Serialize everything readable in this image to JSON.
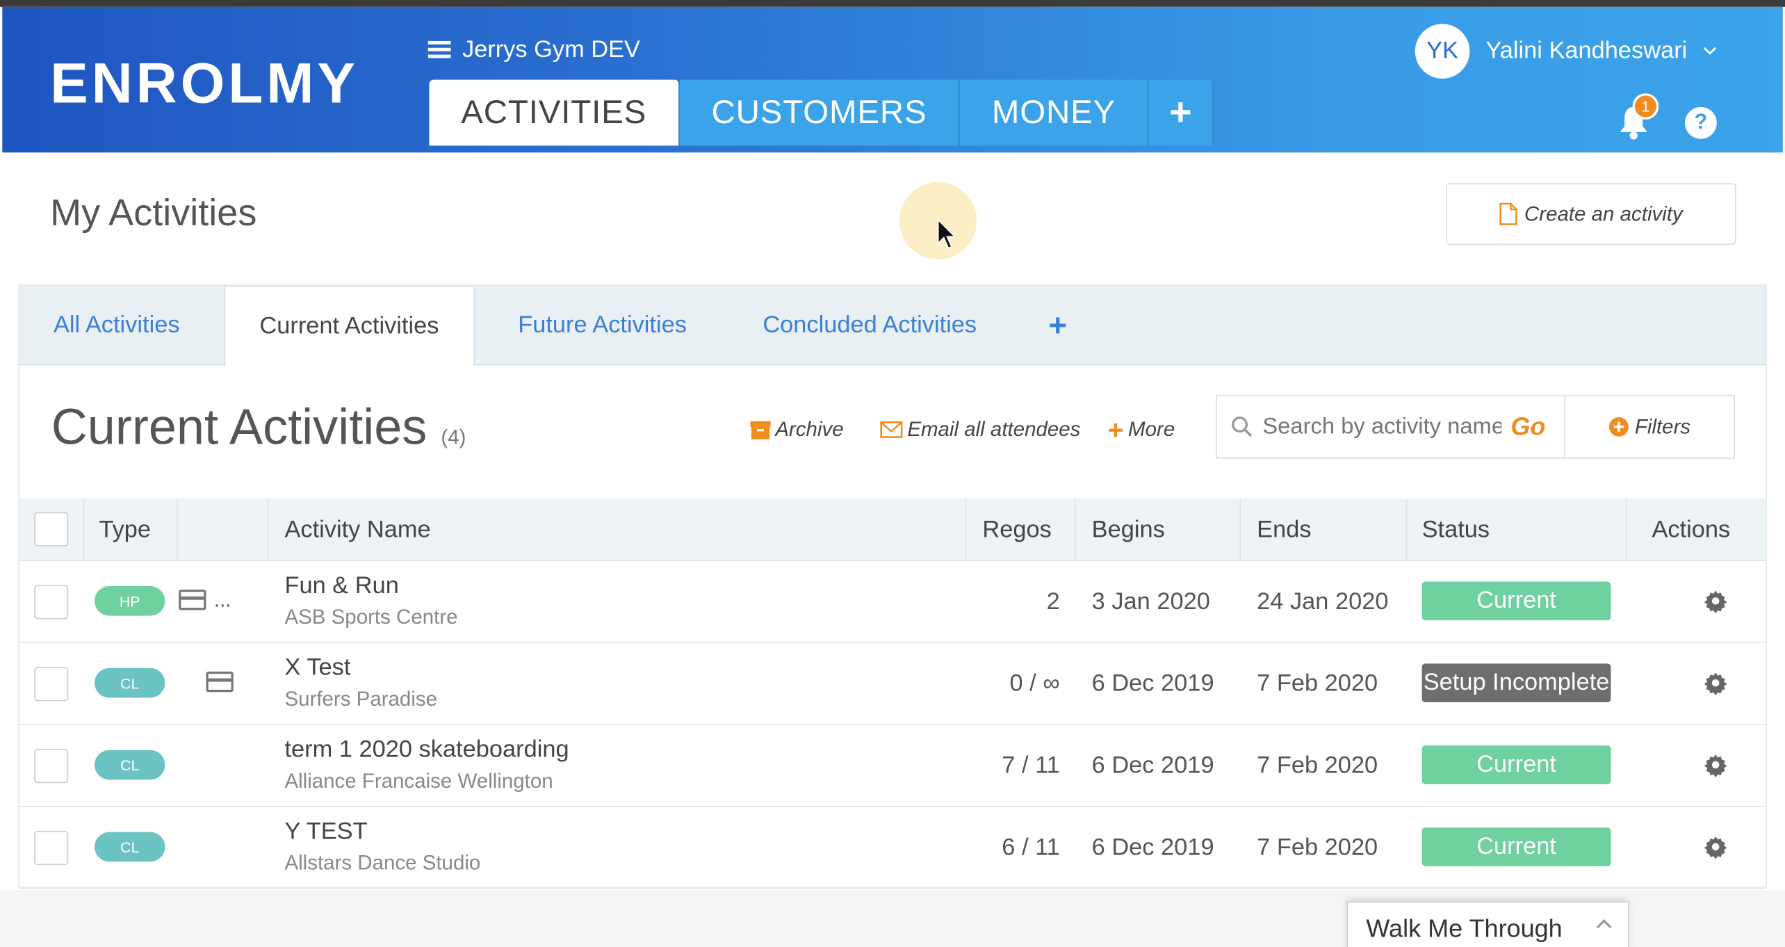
{
  "app": {
    "logo_text": "ENROLMY",
    "gym_name": "Jerrys Gym DEV",
    "brand_color": "#2a6fd0",
    "accent_color": "#f28c1c"
  },
  "nav": {
    "tabs": [
      {
        "label": "ACTIVITIES",
        "active": true
      },
      {
        "label": "CUSTOMERS",
        "active": false
      },
      {
        "label": "MONEY",
        "active": false
      }
    ],
    "add_tab": "+"
  },
  "user": {
    "initials": "YK",
    "name": "Yalini Kandheswari",
    "notification_count": "1",
    "help": "?"
  },
  "page": {
    "title": "My Activities",
    "create_button": "Create an activity"
  },
  "subtabs": [
    {
      "label": "All Activities",
      "active": false
    },
    {
      "label": "Current Activities",
      "active": true
    },
    {
      "label": "Future Activities",
      "active": false
    },
    {
      "label": "Concluded Activities",
      "active": false
    }
  ],
  "subtab_add": "+",
  "section": {
    "title": "Current Activities",
    "count": "(4)",
    "archive": "Archive",
    "email": "Email all attendees",
    "more": "More",
    "search_placeholder": "Search by activity name",
    "go": "Go",
    "filters": "Filters"
  },
  "table": {
    "headers": {
      "type": "Type",
      "name": "Activity Name",
      "regos": "Regos",
      "begins": "Begins",
      "ends": "Ends",
      "status": "Status",
      "actions": "Actions"
    },
    "rows": [
      {
        "type": "HP",
        "icon": "credit-card-icon",
        "extra": "...",
        "name": "Fun & Run",
        "venue": "ASB Sports Centre",
        "regos": "2",
        "begins": "3 Jan 2020",
        "ends": "24 Jan 2020",
        "status": "Current"
      },
      {
        "type": "CL",
        "icon": "credit-card-icon",
        "extra": "",
        "name": "X Test",
        "venue": "Surfers Paradise",
        "regos": "0 / ∞",
        "begins": "6 Dec 2019",
        "ends": "7 Feb 2020",
        "status": "Setup Incomplete"
      },
      {
        "type": "CL",
        "icon": "",
        "extra": "",
        "name": "term 1 2020 skateboarding",
        "venue": "Alliance Francaise Wellington",
        "regos": "7 / 11",
        "begins": "6 Dec 2019",
        "ends": "7 Feb 2020",
        "status": "Current"
      },
      {
        "type": "CL",
        "icon": "",
        "extra": "",
        "name": "Y TEST",
        "venue": "Allstars Dance Studio",
        "regos": "6 / 11",
        "begins": "6 Dec 2019",
        "ends": "7 Feb 2020",
        "status": "Current"
      }
    ]
  },
  "walkthrough": {
    "label": "Walk Me Through"
  }
}
